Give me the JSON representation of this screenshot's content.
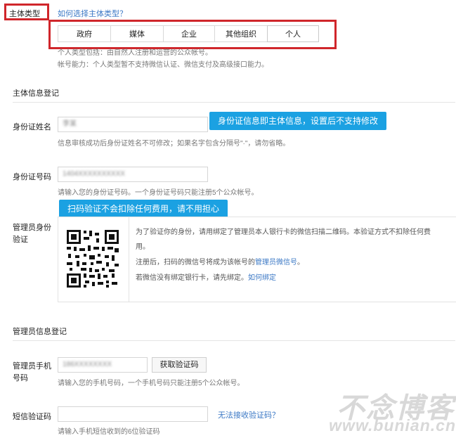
{
  "subject_type": {
    "label": "主体类型",
    "help_link": "如何选择主体类型？",
    "options": [
      "政府",
      "媒体",
      "企业",
      "其他组织",
      "个人"
    ],
    "selected": "个人"
  },
  "notes": {
    "line1": "个人类型包括：由自然人注册和运营的公众帐号。",
    "line2": "帐号能力：个人类型暂不支持微信认证、微信支付及高级接口能力。"
  },
  "subject_info": {
    "section_title": "主体信息登记",
    "id_name": {
      "label": "身份证姓名",
      "value": "李某",
      "hint": "信息审核成功后身份证姓名不可修改；如果名字包含分隔号\"·\"，请勿省略。"
    },
    "id_number": {
      "label": "身份证号码",
      "value": "1404XXXXXXXXXX",
      "hint": "请输入您的身份证号码。一个身份证号码只能注册5个公众帐号。"
    },
    "admin_verify": {
      "label_line1": "管理员身份",
      "label_line2": "验证",
      "text_line1": "为了验证你的身份，请用绑定了管理员本人银行卡的微信扫描二维码。本验证方式不扣除任何费",
      "text_line2": "用。",
      "text_line3_pre": "注册后，扫码的微信号将成为该帐号的",
      "text_line3_link": "管理员微信号",
      "text_line3_post": "。",
      "text_line4_pre": "若微信没有绑定银行卡，请先绑定。",
      "text_line4_link": "如何绑定"
    }
  },
  "admin_info": {
    "section_title": "管理员信息登记",
    "phone": {
      "label_line1": "管理员手机",
      "label_line2": "号码",
      "value": "186XXXXXXXX",
      "button": "获取验证码",
      "hint": "请输入您的手机号码，一个手机号码只能注册5个公众帐号。"
    },
    "sms": {
      "label": "短信验证码",
      "link": "无法接收验证码？",
      "hint": "请输入手机短信收到的6位验证码"
    }
  },
  "tooltips": {
    "tip1": "身份证信息即主体信息，设置后不支持修改",
    "tip2": "扫码验证不会扣除任何费用，请不用担心"
  },
  "watermark": {
    "line1": "不念博客",
    "line2": "www.bunian.cn"
  },
  "colors": {
    "highlight_red": "#d0262b",
    "tip_blue": "#1ba1e2",
    "link_blue": "#3b78c5"
  }
}
